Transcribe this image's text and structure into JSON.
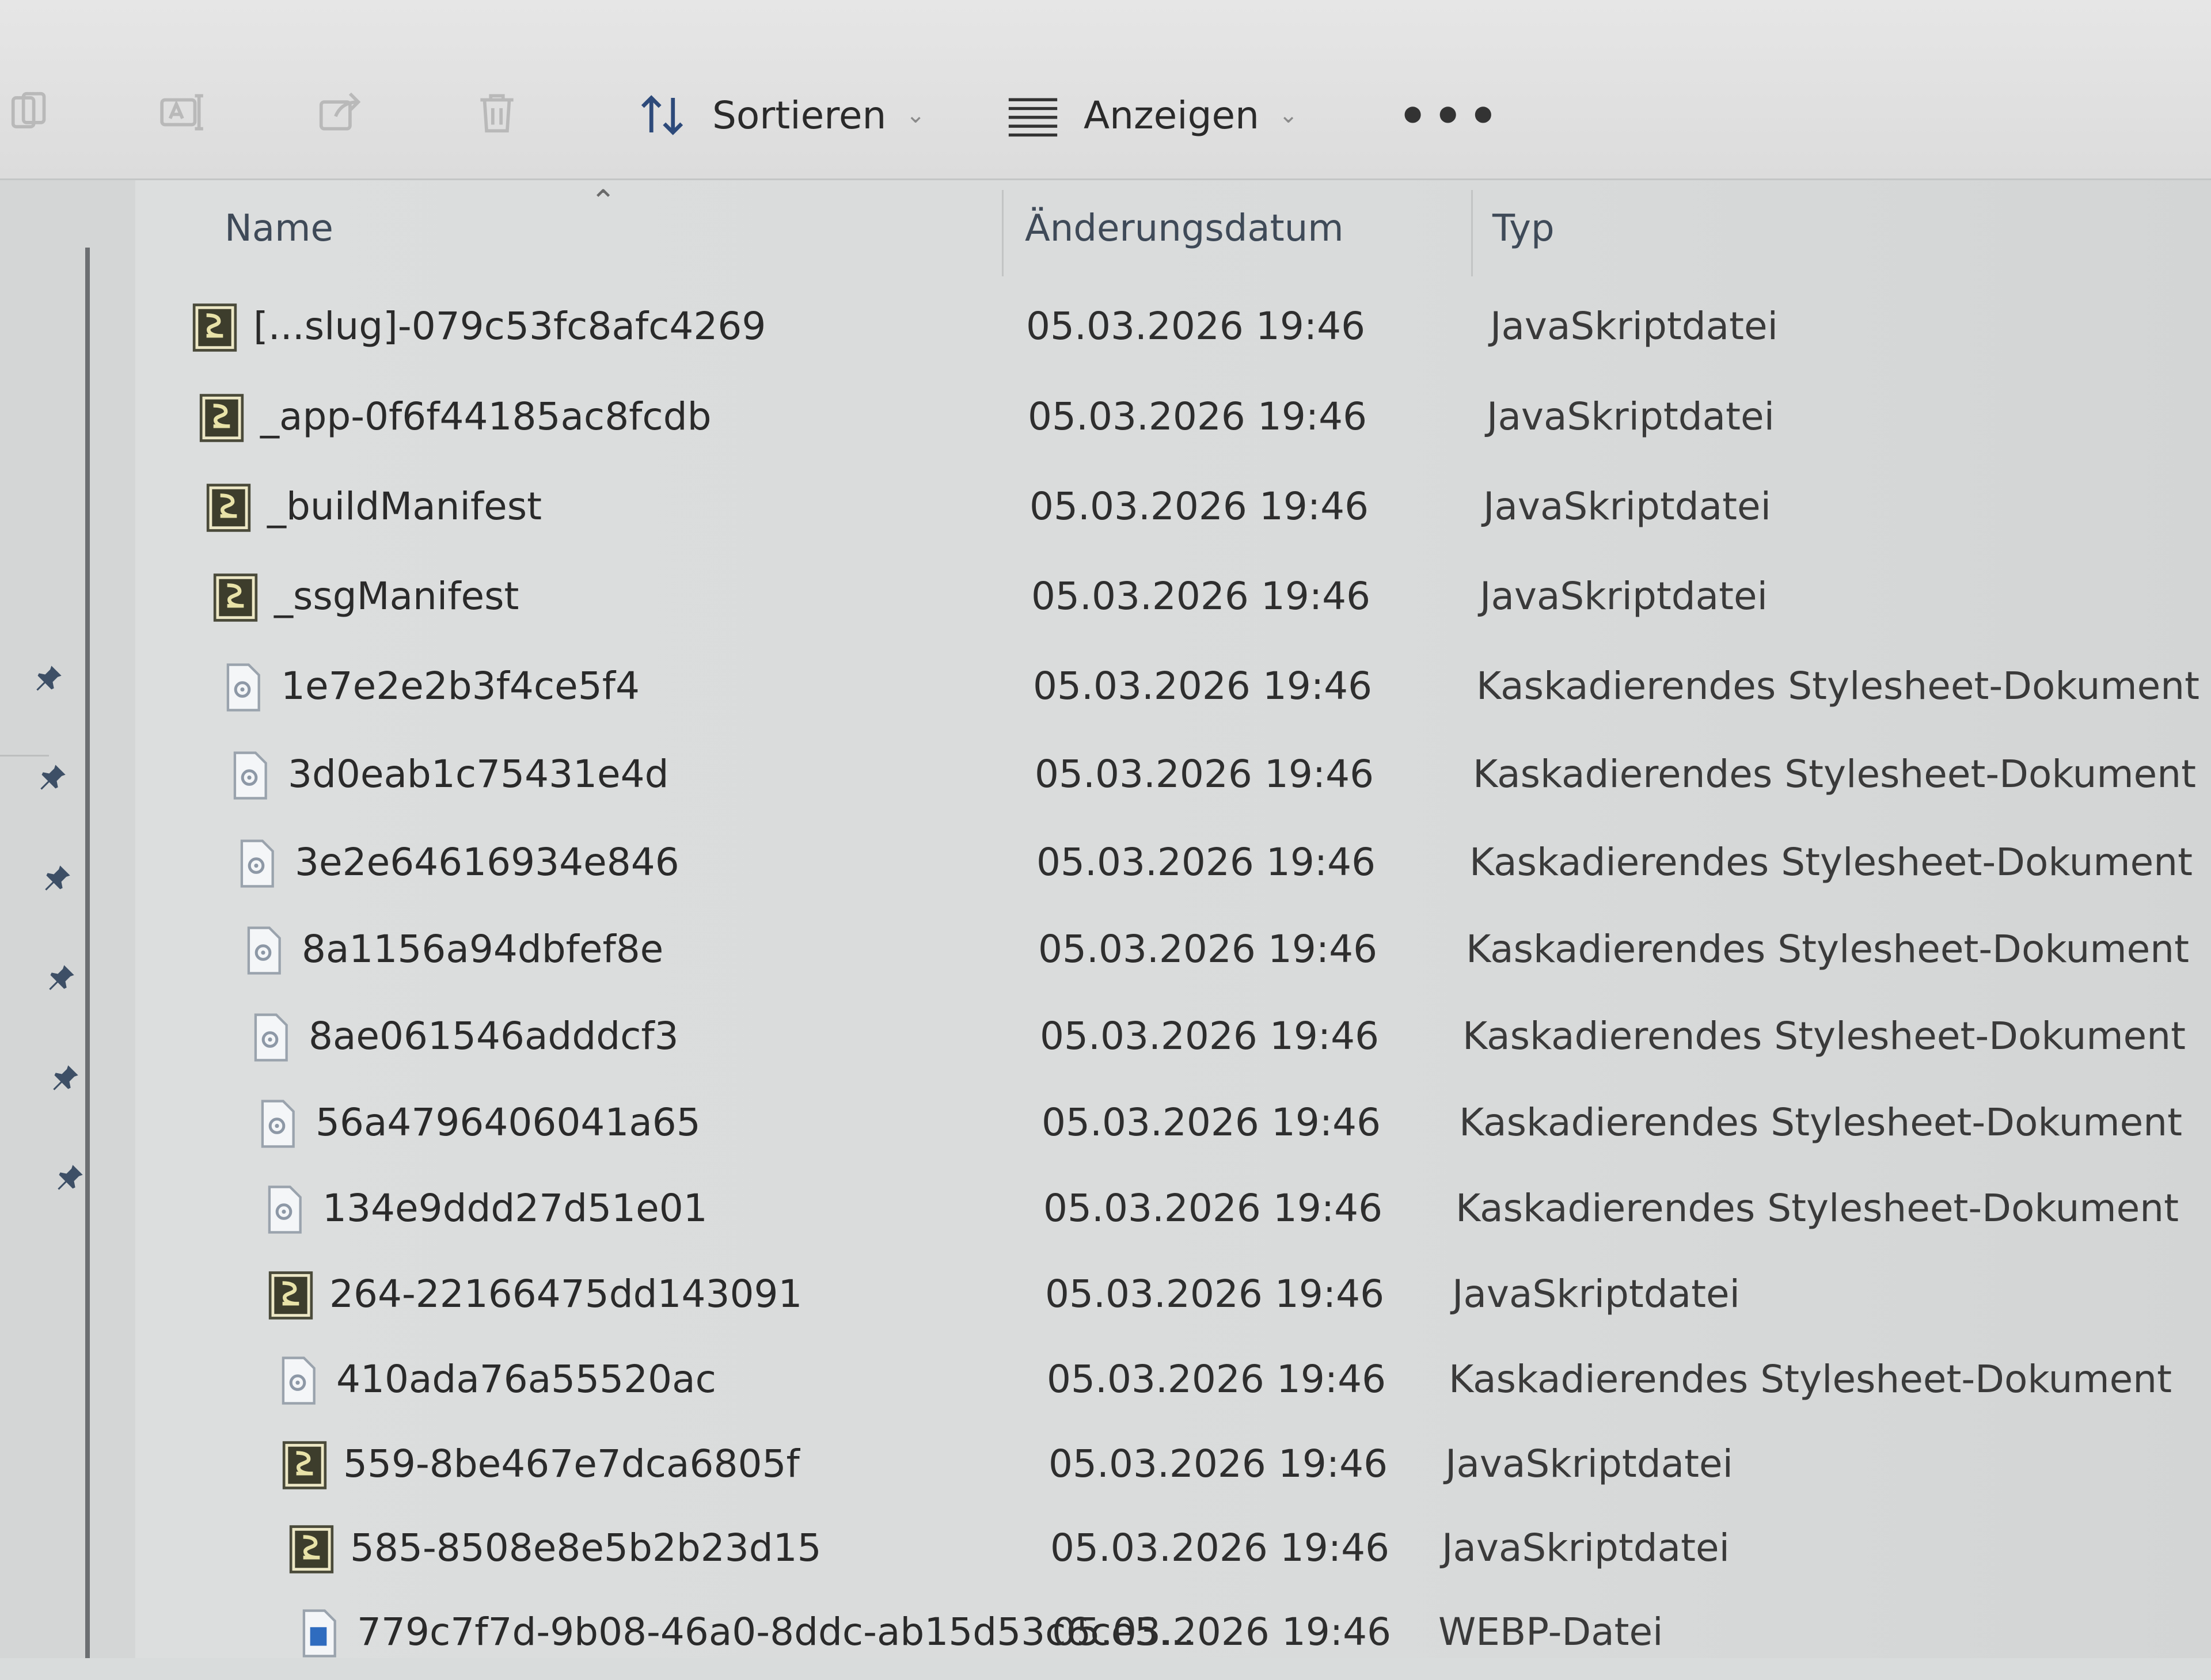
{
  "toolbar": {
    "copy_icon": "copy-icon",
    "rename_icon": "rename-icon",
    "share_icon": "share-icon",
    "delete_icon": "delete-icon",
    "sort_label": "Sortieren",
    "view_label": "Anzeigen",
    "more_label": "•••"
  },
  "columns": {
    "name": "Name",
    "date": "Änderungsdatum",
    "type": "Typ"
  },
  "files": [
    {
      "name": "[...slug]-079c53fc8afc4269",
      "date": "05.03.2026 19:46",
      "type": "JavaSkriptdatei",
      "kind": "js"
    },
    {
      "name": "_app-0f6f44185ac8fcdb",
      "date": "05.03.2026 19:46",
      "type": "JavaSkriptdatei",
      "kind": "js"
    },
    {
      "name": "_buildManifest",
      "date": "05.03.2026 19:46",
      "type": "JavaSkriptdatei",
      "kind": "js"
    },
    {
      "name": "_ssgManifest",
      "date": "05.03.2026 19:46",
      "type": "JavaSkriptdatei",
      "kind": "js"
    },
    {
      "name": "1e7e2e2b3f4ce5f4",
      "date": "05.03.2026 19:46",
      "type": "Kaskadierendes Stylesheet-Dokument",
      "kind": "css"
    },
    {
      "name": "3d0eab1c75431e4d",
      "date": "05.03.2026 19:46",
      "type": "Kaskadierendes Stylesheet-Dokument",
      "kind": "css"
    },
    {
      "name": "3e2e64616934e846",
      "date": "05.03.2026 19:46",
      "type": "Kaskadierendes Stylesheet-Dokument",
      "kind": "css"
    },
    {
      "name": "8a1156a94dbfef8e",
      "date": "05.03.2026 19:46",
      "type": "Kaskadierendes Stylesheet-Dokument",
      "kind": "css"
    },
    {
      "name": "8ae061546adddcf3",
      "date": "05.03.2026 19:46",
      "type": "Kaskadierendes Stylesheet-Dokument",
      "kind": "css"
    },
    {
      "name": "56a4796406041a65",
      "date": "05.03.2026 19:46",
      "type": "Kaskadierendes Stylesheet-Dokument",
      "kind": "css"
    },
    {
      "name": "134e9ddd27d51e01",
      "date": "05.03.2026 19:46",
      "type": "Kaskadierendes Stylesheet-Dokument",
      "kind": "css"
    },
    {
      "name": "264-22166475dd143091",
      "date": "05.03.2026 19:46",
      "type": "JavaSkriptdatei",
      "kind": "js"
    },
    {
      "name": "410ada76a55520ac",
      "date": "05.03.2026 19:46",
      "type": "Kaskadierendes Stylesheet-Dokument",
      "kind": "css"
    },
    {
      "name": "559-8be467e7dca6805f",
      "date": "05.03.2026 19:46",
      "type": "JavaSkriptdatei",
      "kind": "js"
    },
    {
      "name": "585-8508e8e5b2b23d15",
      "date": "05.03.2026 19:46",
      "type": "JavaSkriptdatei",
      "kind": "js"
    },
    {
      "name": "779c7f7d-9b08-46a0-8ddc-ab15d53c6ce5...",
      "date": "05.03.2026 19:46",
      "type": "WEBP-Datei",
      "kind": "webp"
    }
  ],
  "nav": {
    "pin_icon": "pin-icon"
  }
}
